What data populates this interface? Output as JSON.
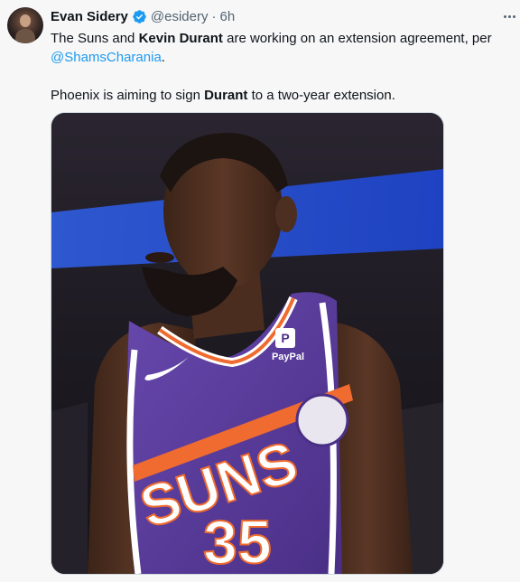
{
  "tweet": {
    "author_name": "Evan Sidery",
    "author_handle": "@esidery",
    "separator": "·",
    "time": "6h",
    "text": {
      "line1_a": "The Suns and ",
      "line1_bold": "Kevin Durant",
      "line1_b": " are working on an extension agreement, per ",
      "mention": "@ShamsCharania",
      "line1_end": ".",
      "line2_a": "Phoenix is aiming to sign ",
      "line2_bold": "Durant",
      "line2_b": " to a two-year extension."
    },
    "media": {
      "jersey_text": "SUNS",
      "jersey_number": "35",
      "sponsor": "PayPal"
    }
  },
  "icons": {
    "verified": "verified-badge-icon",
    "more": "more-options-icon"
  },
  "colors": {
    "link": "#1d9bf0",
    "secondary": "#536471",
    "jersey_purple": "#5a3d9a",
    "jersey_orange": "#ef6b2f"
  }
}
